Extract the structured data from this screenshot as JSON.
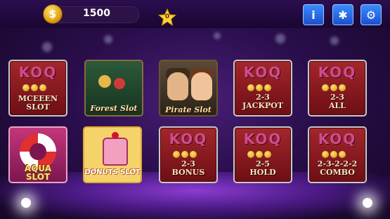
{
  "header": {
    "coin_symbol": "$",
    "coins": "1500",
    "star_count": "0",
    "buttons": [
      {
        "icon": "info-icon",
        "glyph": "i"
      },
      {
        "icon": "wheel-icon",
        "glyph": "✱"
      },
      {
        "icon": "gear-icon",
        "glyph": "⚙"
      }
    ]
  },
  "games": [
    {
      "id": "mceeen",
      "logo": "KOQ",
      "label": "MCEEEN SLOT"
    },
    {
      "id": "forest",
      "label": "Forest Slot"
    },
    {
      "id": "pirate",
      "label": "Pirate Slot"
    },
    {
      "id": "jackpot",
      "logo": "KOQ",
      "label_line1": "2-3",
      "label_line2": "JACKPOT"
    },
    {
      "id": "all",
      "logo": "KOQ",
      "label_line1": "2-3",
      "label_line2": "ALL"
    },
    {
      "id": "aqua",
      "label_line1": "AQUA",
      "label_line2": "SLOT"
    },
    {
      "id": "donuts",
      "label": "DONUTS SLOT"
    },
    {
      "id": "bonus",
      "logo": "KOQ",
      "label_line1": "2-3",
      "label_line2": "BONUS"
    },
    {
      "id": "hold",
      "logo": "KOQ",
      "label_line1": "2-5",
      "label_line2": "HOLD"
    },
    {
      "id": "combo",
      "logo": "KOQ",
      "label_line1": "2-3-2-2-2",
      "label_line2": "COMBO"
    }
  ],
  "colors": {
    "accent_blue": "#2a6cf0",
    "tile_red": "#a3272b",
    "gold": "#e0a210"
  }
}
